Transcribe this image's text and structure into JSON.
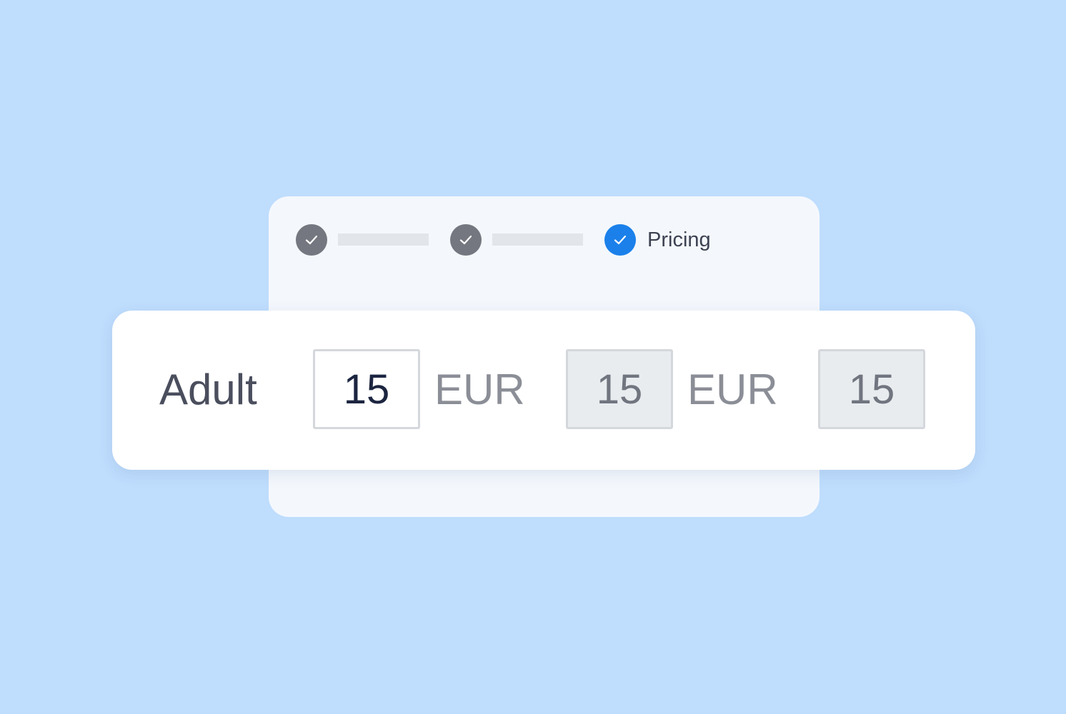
{
  "stepper": {
    "steps": [
      {
        "status": "done",
        "icon": "check-icon"
      },
      {
        "status": "done",
        "icon": "check-icon"
      },
      {
        "status": "active",
        "icon": "check-icon",
        "label": "Pricing"
      }
    ],
    "colors": {
      "done": "#74777f",
      "active": "#1b80ea"
    }
  },
  "pricing_row": {
    "label": "Adult",
    "fields": [
      {
        "value": "15",
        "currency": "EUR",
        "editable": true
      },
      {
        "value": "15",
        "currency": "EUR",
        "editable": false
      },
      {
        "value": "15",
        "editable": false
      }
    ]
  },
  "colors": {
    "background": "#bfddfd",
    "back_card": "#f4f8fd",
    "front_card": "#ffffff"
  }
}
